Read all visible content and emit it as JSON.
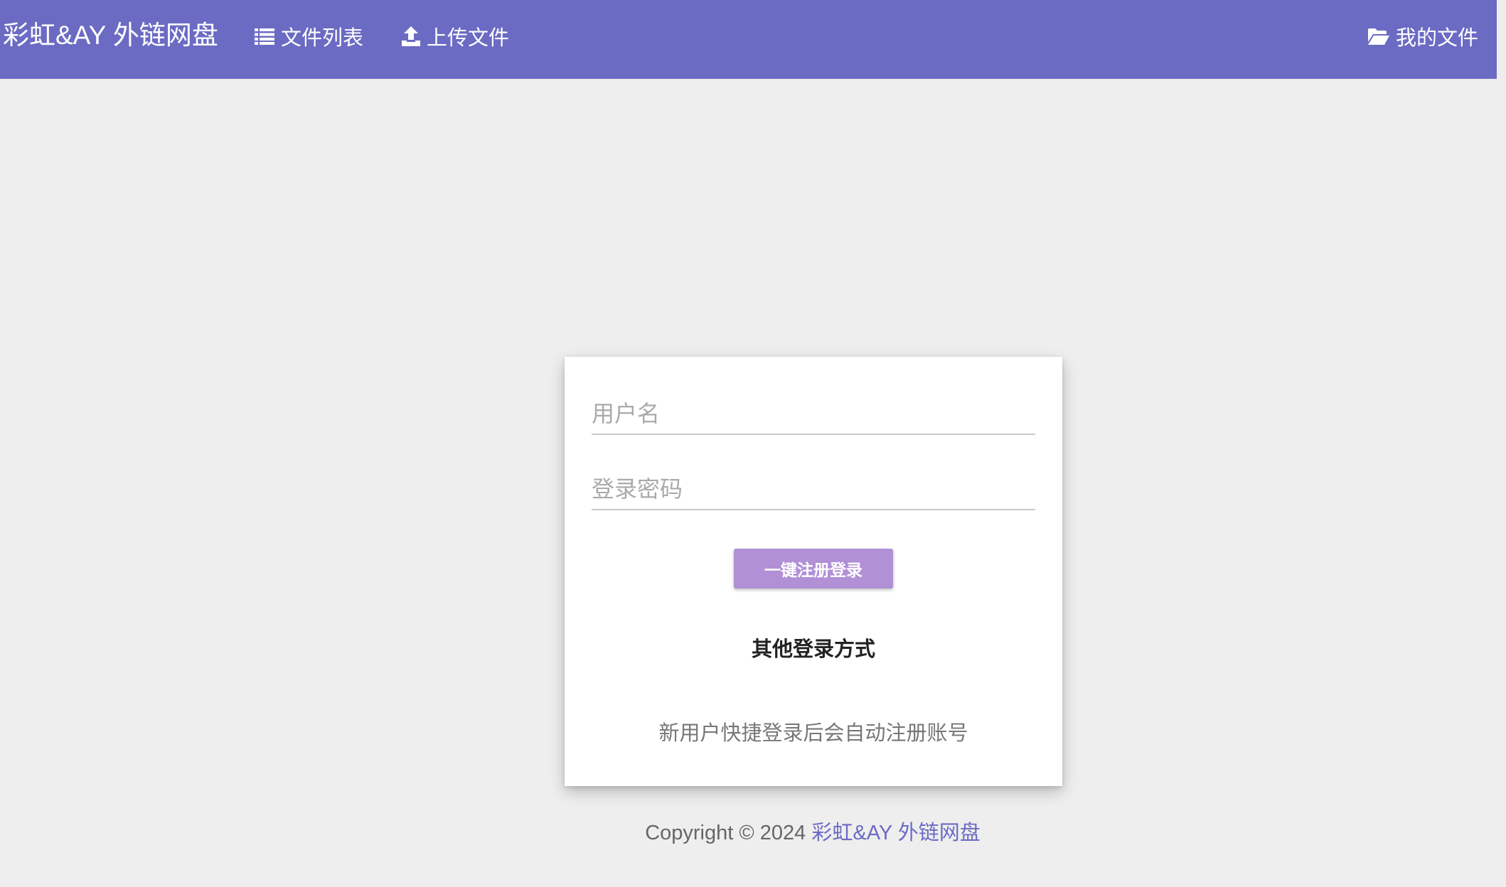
{
  "header": {
    "brand": "彩虹&AY 外链网盘",
    "nav": [
      {
        "label": "文件列表",
        "icon": "list-icon"
      },
      {
        "label": "上传文件",
        "icon": "upload-icon"
      }
    ],
    "right_nav": {
      "label": "我的文件",
      "icon": "folder-open-icon"
    },
    "color": "#6b6bc4"
  },
  "login": {
    "username_placeholder": "用户名",
    "username_value": "",
    "password_placeholder": "登录密码",
    "password_value": "",
    "submit_label": "一键注册登录",
    "submit_color": "#b190d6",
    "other_login": "其他登录方式",
    "hint": "新用户快捷登录后会自动注册账号"
  },
  "footer": {
    "prefix": "Copyright © 2024 ",
    "link": "彩虹&AY 外链网盘"
  }
}
